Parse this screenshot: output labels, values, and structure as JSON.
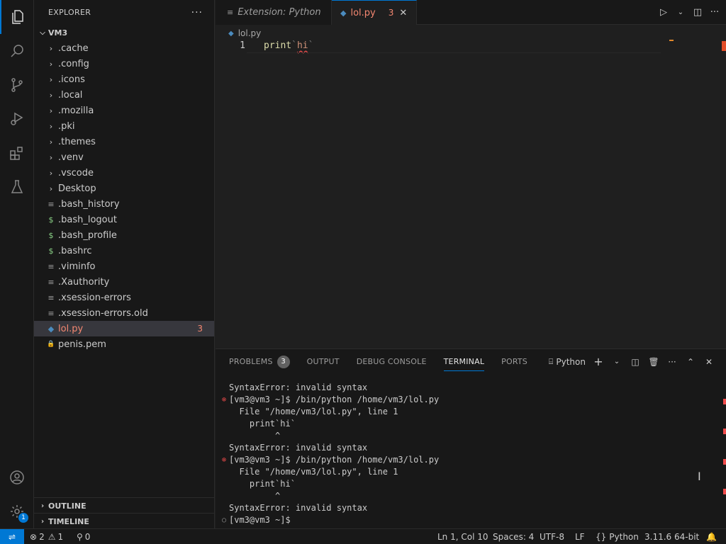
{
  "activity_bar": {
    "items": [
      "explorer",
      "search",
      "source-control",
      "run-debug",
      "extensions",
      "testing"
    ],
    "bottom": [
      "account",
      "manage"
    ],
    "manage_badge": "1"
  },
  "sidebar": {
    "title": "EXPLORER",
    "more": "···",
    "root": "VM3",
    "items": [
      {
        "name": ".cache",
        "kind": "folder"
      },
      {
        "name": ".config",
        "kind": "folder"
      },
      {
        "name": ".icons",
        "kind": "folder"
      },
      {
        "name": ".local",
        "kind": "folder"
      },
      {
        "name": ".mozilla",
        "kind": "folder"
      },
      {
        "name": ".pki",
        "kind": "folder"
      },
      {
        "name": ".themes",
        "kind": "folder"
      },
      {
        "name": ".venv",
        "kind": "folder"
      },
      {
        "name": ".vscode",
        "kind": "folder"
      },
      {
        "name": "Desktop",
        "kind": "folder"
      },
      {
        "name": ".bash_history",
        "kind": "text"
      },
      {
        "name": ".bash_logout",
        "kind": "shell"
      },
      {
        "name": ".bash_profile",
        "kind": "shell"
      },
      {
        "name": ".bashrc",
        "kind": "shell"
      },
      {
        "name": ".viminfo",
        "kind": "text"
      },
      {
        "name": ".Xauthority",
        "kind": "text"
      },
      {
        "name": ".xsession-errors",
        "kind": "text"
      },
      {
        "name": ".xsession-errors.old",
        "kind": "text"
      },
      {
        "name": "lol.py",
        "kind": "python",
        "errors": "3"
      },
      {
        "name": "penis.pem",
        "kind": "lock"
      }
    ],
    "outline_label": "OUTLINE",
    "timeline_label": "TIMELINE"
  },
  "tabs": [
    {
      "label": "Extension: Python",
      "active": false
    },
    {
      "label": "lol.py",
      "active": true,
      "errors": "3",
      "close": "✕"
    }
  ],
  "breadcrumb": "lol.py",
  "editor": {
    "line_number": "1",
    "code": {
      "fn": "print",
      "err1": "`",
      "str": "hi",
      "err2": "`"
    }
  },
  "panel": {
    "tabs": [
      {
        "label": "PROBLEMS",
        "badge": "3"
      },
      {
        "label": "OUTPUT"
      },
      {
        "label": "DEBUG CONSOLE"
      },
      {
        "label": "TERMINAL",
        "active": true
      },
      {
        "label": "PORTS"
      }
    ],
    "terminal_name": "Python",
    "lines": [
      {
        "text": "SyntaxError: invalid syntax",
        "marker": ""
      },
      {
        "text": "[vm3@vm3 ~]$ /bin/python /home/vm3/lol.py",
        "marker": "error"
      },
      {
        "text": "  File \"/home/vm3/lol.py\", line 1",
        "marker": ""
      },
      {
        "text": "    print`hi`",
        "marker": ""
      },
      {
        "text": "         ^",
        "marker": ""
      },
      {
        "text": "SyntaxError: invalid syntax",
        "marker": ""
      },
      {
        "text": "[vm3@vm3 ~]$ /bin/python /home/vm3/lol.py",
        "marker": "error"
      },
      {
        "text": "  File \"/home/vm3/lol.py\", line 1",
        "marker": ""
      },
      {
        "text": "    print`hi`",
        "marker": ""
      },
      {
        "text": "         ^",
        "marker": ""
      },
      {
        "text": "SyntaxError: invalid syntax",
        "marker": ""
      },
      {
        "text": "[vm3@vm3 ~]$ ",
        "marker": "neutral"
      }
    ]
  },
  "statusbar": {
    "remote": "⇌",
    "errors": "2",
    "warnings": "1",
    "ports": "0",
    "position": "Ln 1, Col 10",
    "spaces": "Spaces: 4",
    "encoding": "UTF-8",
    "eol": "LF",
    "language": "Python",
    "interpreter": "3.11.6 64-bit"
  },
  "colors": {
    "accent": "#0078d4",
    "error": "#f48771",
    "background": "#1f1f1f",
    "sidebar": "#181818"
  }
}
